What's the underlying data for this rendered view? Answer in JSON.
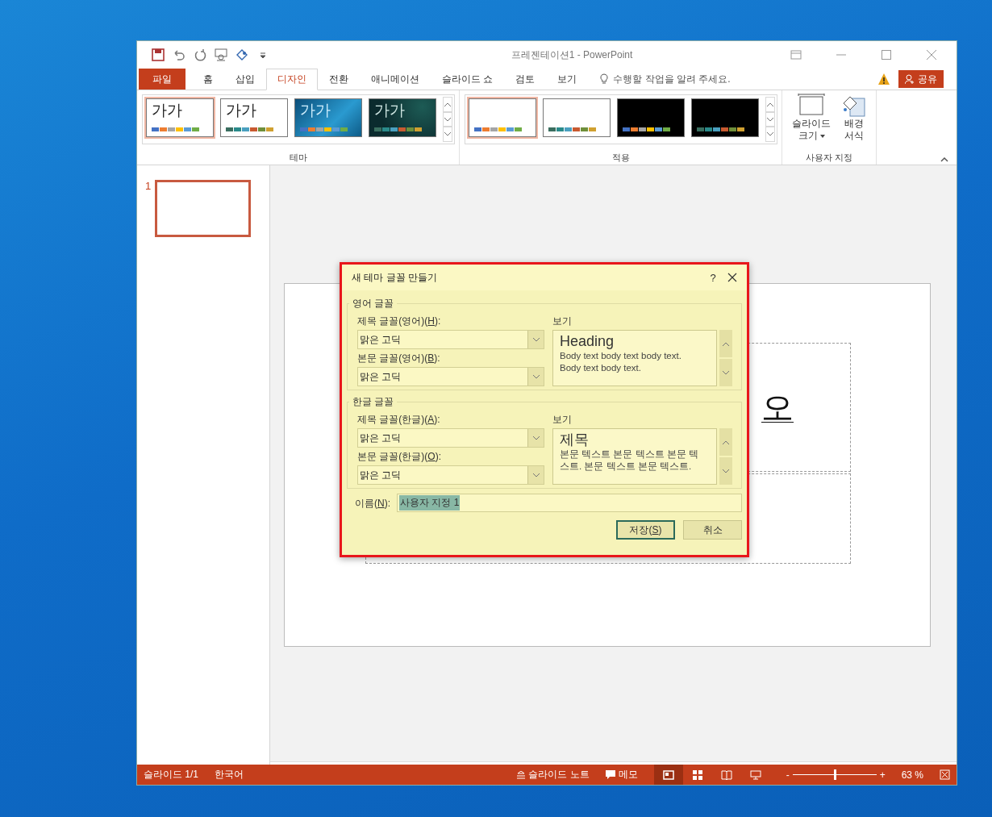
{
  "window": {
    "title": "프레젠테이션1 - PowerPoint"
  },
  "tabs": [
    {
      "label": "파일",
      "kind": "file",
      "selected": false
    },
    {
      "label": "홈",
      "kind": "tab",
      "selected": false
    },
    {
      "label": "삽입",
      "kind": "tab",
      "selected": false
    },
    {
      "label": "디자인",
      "kind": "tab",
      "selected": true
    },
    {
      "label": "전환",
      "kind": "tab",
      "selected": false
    },
    {
      "label": "애니메이션",
      "kind": "tab",
      "selected": false
    },
    {
      "label": "슬라이드 쇼",
      "kind": "tab",
      "selected": false
    },
    {
      "label": "검토",
      "kind": "tab",
      "selected": false
    },
    {
      "label": "보기",
      "kind": "tab",
      "selected": false
    }
  ],
  "tell_me": {
    "placeholder": "수행할 작업을 알려 주세요."
  },
  "share_button": {
    "label": "공유"
  },
  "ribbon": {
    "themes": {
      "label": "테마",
      "items": [
        {
          "text": "가가",
          "kind": "white",
          "selected": true
        },
        {
          "text": "가가",
          "kind": "white",
          "selected": false
        },
        {
          "text": "가가",
          "kind": "blue",
          "selected": false
        },
        {
          "text": "가가",
          "kind": "dark",
          "selected": false
        }
      ]
    },
    "variants": {
      "label": "적용",
      "items": [
        {
          "kind": "white",
          "selected": true
        },
        {
          "kind": "white",
          "selected": false
        },
        {
          "kind": "black",
          "selected": false
        },
        {
          "kind": "black",
          "selected": false
        }
      ]
    },
    "customize": {
      "label": "사용자 지정",
      "buttons": [
        {
          "kind": "slide-size",
          "lines": [
            "슬라이드",
            "크기"
          ],
          "dropdown": true
        },
        {
          "kind": "background",
          "lines": [
            "배경",
            "서식"
          ],
          "dropdown": false
        }
      ]
    }
  },
  "slides": [
    {
      "number": "1",
      "selected": true
    }
  ],
  "slide": {
    "title_text": "오"
  },
  "dialog": {
    "title": "새 테마 글꼴 만들기",
    "help": "?",
    "sections": [
      {
        "legend": "영어 글꼴",
        "fields": [
          {
            "label_before": "제목 글꼴(영어)(",
            "access_key": "H",
            "label_after": "):",
            "value": "맑은 고딕"
          },
          {
            "label_before": "본문 글꼴(영어)(",
            "access_key": "B",
            "label_after": "):",
            "value": "맑은 고딕"
          }
        ],
        "preview_label": "보기",
        "preview_heading": "Heading",
        "preview_body": "Body text body text body text. Body text body text."
      },
      {
        "legend": "한글 글꼴",
        "fields": [
          {
            "label_before": "제목 글꼴(한글)(",
            "access_key": "A",
            "label_after": "):",
            "value": "맑은 고딕"
          },
          {
            "label_before": "본문 글꼴(한글)(",
            "access_key": "O",
            "label_after": "):",
            "value": "맑은 고딕"
          }
        ],
        "preview_label": "보기",
        "preview_heading": "제목",
        "preview_body": "본문 텍스트 본문 텍스트 본문 텍스트. 본문 텍스트 본문 텍스트."
      }
    ],
    "name_field": {
      "label_before": "이름(",
      "access_key": "N",
      "label_after": "):",
      "value": "사용자 지정 1",
      "selected": true
    },
    "buttons": [
      {
        "label_before": "저장(",
        "access_key": "S",
        "label_after": ")",
        "default": true
      },
      {
        "label_before": "취소",
        "default": false
      }
    ]
  },
  "status_bar": {
    "slide_info": "슬라이드 1/1",
    "language": "한국어",
    "notes": "슬라이드 노트",
    "comments": "메모",
    "views": [
      {
        "kind": "normal",
        "selected": true
      },
      {
        "kind": "sorter",
        "selected": false
      },
      {
        "kind": "reading",
        "selected": false
      },
      {
        "kind": "show",
        "selected": false
      }
    ],
    "zoom_out": "-",
    "zoom_in": "+",
    "zoom": {
      "level": 0.5,
      "reading": "63 %"
    }
  }
}
